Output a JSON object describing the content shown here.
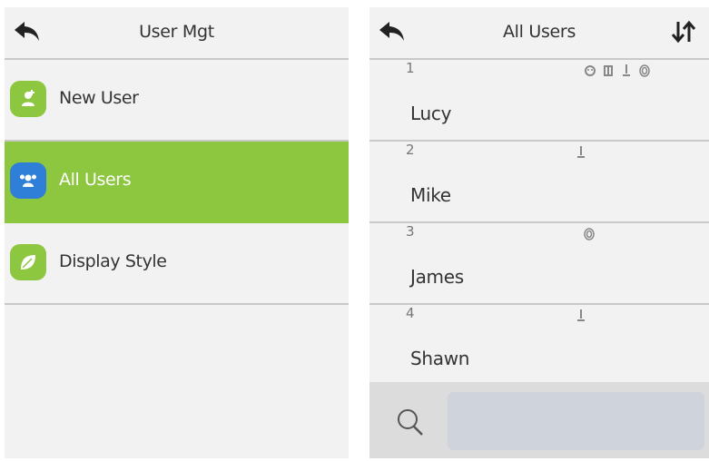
{
  "user_mgt": {
    "title": "User Mgt",
    "menu": [
      {
        "label": "New User",
        "icon": "add-user-icon",
        "color": "#8dc63f",
        "active": false
      },
      {
        "label": "All Users",
        "icon": "all-users-icon",
        "color": "#2f7fd8",
        "active": true
      },
      {
        "label": "Display Style",
        "icon": "display-style-icon",
        "color": "#8dc63f",
        "active": false
      }
    ]
  },
  "all_users": {
    "title": "All Users",
    "users": [
      {
        "id": "1",
        "name": "Lucy",
        "credentials": [
          "face-icon",
          "card-icon",
          "password-icon",
          "fingerprint-icon"
        ]
      },
      {
        "id": "2",
        "name": "Mike",
        "credentials": [
          "password-icon"
        ]
      },
      {
        "id": "3",
        "name": "James",
        "credentials": [
          "fingerprint-icon"
        ]
      },
      {
        "id": "4",
        "name": "Shawn",
        "credentials": [
          "password-icon"
        ]
      }
    ],
    "search": {
      "placeholder": "",
      "value": ""
    }
  },
  "colors": {
    "accent_green": "#8dc63f",
    "icon_blue": "#2f7fd8",
    "panel_bg": "#f2f2f2",
    "divider": "#c9c9c9"
  }
}
